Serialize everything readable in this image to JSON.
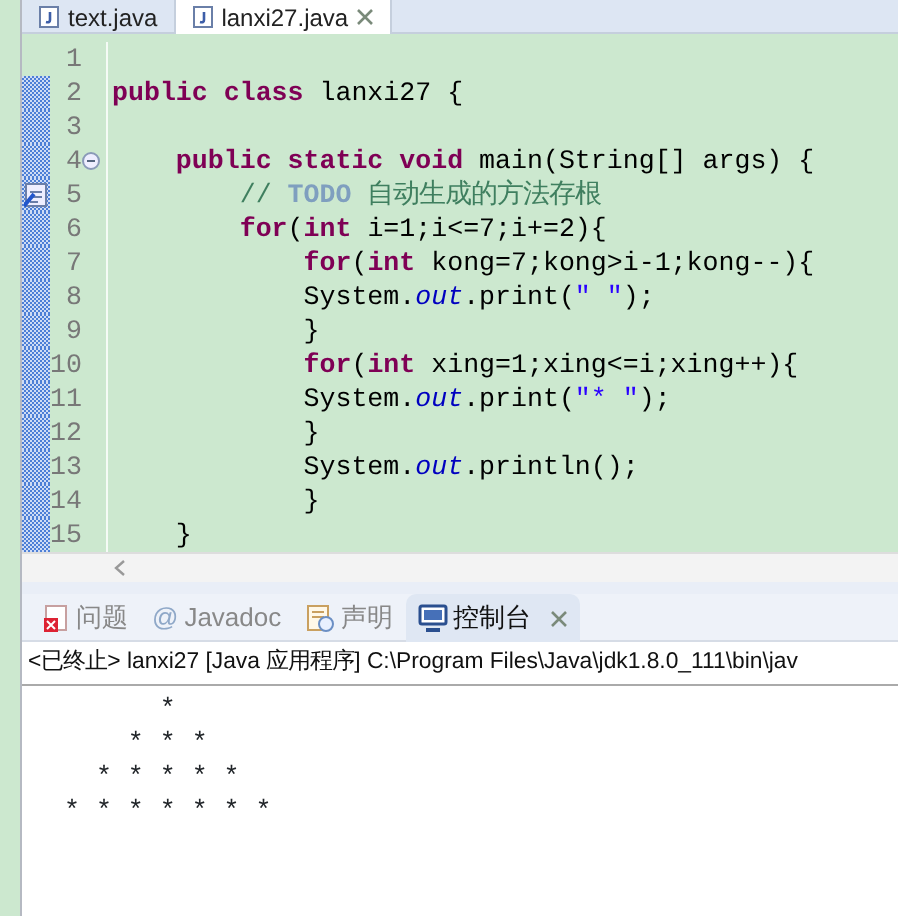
{
  "editor_tabs": [
    {
      "label": "text.java",
      "selected": false,
      "closable": false
    },
    {
      "label": "lanxi27.java",
      "selected": true,
      "closable": true
    }
  ],
  "code_lines": [
    {
      "number": "1",
      "changed": false,
      "collapsible": false,
      "task_marker": false
    },
    {
      "number": "2",
      "changed": true,
      "collapsible": false,
      "task_marker": false,
      "tokens": [
        {
          "text": "public class",
          "kind": "keyword"
        },
        {
          "text": " lanxi27 {",
          "kind": "plain"
        }
      ]
    },
    {
      "number": "3",
      "changed": true,
      "collapsible": false,
      "task_marker": false
    },
    {
      "number": "4",
      "changed": true,
      "collapsible": true,
      "task_marker": false,
      "tokens": [
        {
          "text": "    public static void",
          "kind": "keyword"
        },
        {
          "text": " main(String[] args) {",
          "kind": "plain"
        }
      ]
    },
    {
      "number": "5",
      "changed": true,
      "collapsible": false,
      "task_marker": true,
      "tokens": [
        {
          "text": "        // ",
          "kind": "comment"
        },
        {
          "text": "TODO",
          "kind": "todo"
        },
        {
          "text": " 自动生成的方法存根",
          "kind": "comment"
        }
      ]
    },
    {
      "number": "6",
      "changed": true,
      "collapsible": false,
      "task_marker": false,
      "tokens": [
        {
          "text": "        for",
          "kind": "keyword"
        },
        {
          "text": "(",
          "kind": "plain"
        },
        {
          "text": "int",
          "kind": "keyword"
        },
        {
          "text": " i=1;i<=7;i+=2){",
          "kind": "plain"
        }
      ]
    },
    {
      "number": "7",
      "changed": true,
      "collapsible": false,
      "task_marker": false,
      "tokens": [
        {
          "text": "            for",
          "kind": "keyword"
        },
        {
          "text": "(",
          "kind": "plain"
        },
        {
          "text": "int",
          "kind": "keyword"
        },
        {
          "text": " kong=7;kong>i-1;kong--){",
          "kind": "plain"
        }
      ]
    },
    {
      "number": "8",
      "changed": true,
      "collapsible": false,
      "task_marker": false,
      "tokens": [
        {
          "text": "            System.",
          "kind": "plain"
        },
        {
          "text": "out",
          "kind": "field"
        },
        {
          "text": ".print(",
          "kind": "plain"
        },
        {
          "text": "\" \"",
          "kind": "string"
        },
        {
          "text": ");",
          "kind": "plain"
        }
      ]
    },
    {
      "number": "9",
      "changed": true,
      "collapsible": false,
      "task_marker": false,
      "tokens": [
        {
          "text": "            }",
          "kind": "plain"
        }
      ]
    },
    {
      "number": "10",
      "changed": true,
      "collapsible": false,
      "task_marker": false,
      "tokens": [
        {
          "text": "            for",
          "kind": "keyword"
        },
        {
          "text": "(",
          "kind": "plain"
        },
        {
          "text": "int",
          "kind": "keyword"
        },
        {
          "text": " xing=1;xing<=i;xing++){",
          "kind": "plain"
        }
      ]
    },
    {
      "number": "11",
      "changed": true,
      "collapsible": false,
      "task_marker": false,
      "tokens": [
        {
          "text": "            System.",
          "kind": "plain"
        },
        {
          "text": "out",
          "kind": "field"
        },
        {
          "text": ".print(",
          "kind": "plain"
        },
        {
          "text": "\"* \"",
          "kind": "string"
        },
        {
          "text": ");",
          "kind": "plain"
        }
      ]
    },
    {
      "number": "12",
      "changed": true,
      "collapsible": false,
      "task_marker": false,
      "tokens": [
        {
          "text": "            }",
          "kind": "plain"
        }
      ]
    },
    {
      "number": "13",
      "changed": true,
      "collapsible": false,
      "task_marker": false,
      "tokens": [
        {
          "text": "            System.",
          "kind": "plain"
        },
        {
          "text": "out",
          "kind": "field"
        },
        {
          "text": ".println();",
          "kind": "plain"
        }
      ]
    },
    {
      "number": "14",
      "changed": true,
      "collapsible": false,
      "task_marker": false,
      "tokens": [
        {
          "text": "            }",
          "kind": "plain"
        }
      ]
    },
    {
      "number": "15",
      "changed": true,
      "collapsible": false,
      "task_marker": false,
      "tokens": [
        {
          "text": "    }",
          "kind": "plain"
        }
      ]
    }
  ],
  "view_tabs": [
    {
      "label": "问题",
      "selected": false,
      "closable": false
    },
    {
      "icon_text": "@",
      "label": "Javadoc",
      "selected": false,
      "closable": false
    },
    {
      "label": "声明",
      "selected": false,
      "closable": false
    },
    {
      "label": "控制台",
      "selected": true,
      "closable": true
    }
  ],
  "console": {
    "header": "<已终止> lanxi27 [Java 应用程序] C:\\Program Files\\Java\\jdk1.8.0_111\\bin\\jav",
    "output": "       *\n     * * *\n   * * * * *\n * * * * * * *"
  }
}
